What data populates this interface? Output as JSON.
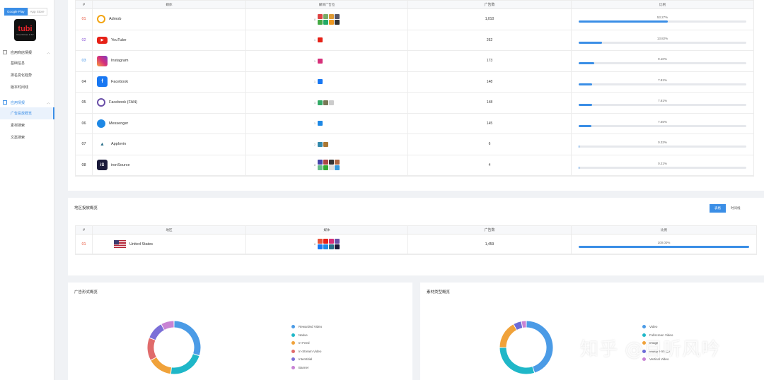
{
  "sidebar": {
    "store_tabs": [
      "Google Play",
      "App Store"
    ],
    "app_logo_text": "tubi",
    "app_logo_sub": "Free Movies & TV",
    "groups": [
      {
        "label": "应用商店情报",
        "items": [
          "基础信息",
          "排名变化趋势",
          "版本时间线"
        ]
      },
      {
        "label": "应用情报",
        "items": [
          "广告投放概览",
          "素材搜索",
          "文案搜索"
        ]
      }
    ]
  },
  "media_table": {
    "headers": [
      "#",
      "媒体",
      "媒体广告位",
      "广告数",
      "比例"
    ],
    "rows": [
      {
        "num": "01",
        "name": "Admob",
        "count": "1,010",
        "ratio": "53.27%",
        "pct": 53.27,
        "numColor": "#e8533b",
        "icon": "admob-icon",
        "iconColor": "#fff",
        "pos_n": "8",
        "thumbs": [
          "#d44",
          "#7a6",
          "#d93",
          "#556",
          "#4a4",
          "#2a6",
          "#e92",
          "#333"
        ]
      },
      {
        "num": "02",
        "name": "YouTube",
        "count": "262",
        "ratio": "13.82%",
        "pct": 13.82,
        "numColor": "#8a56d8",
        "icon": "youtube-icon",
        "iconColor": "#e62117",
        "pos_n": "1",
        "thumbs": [
          "#e62117"
        ]
      },
      {
        "num": "03",
        "name": "Instagram",
        "count": "173",
        "ratio": "9.10%",
        "pct": 9.1,
        "numColor": "#3a8ee6",
        "icon": "instagram-icon",
        "iconColor": "#d6307a",
        "pos_n": "1",
        "thumbs": [
          "#d6307a"
        ]
      },
      {
        "num": "04",
        "name": "Facebook",
        "count": "148",
        "ratio": "7.81%",
        "pct": 7.81,
        "numColor": "#333",
        "icon": "facebook-icon",
        "iconColor": "#1877f2",
        "pos_n": "1",
        "thumbs": [
          "#1877f2"
        ]
      },
      {
        "num": "05",
        "name": "Facebook (FAN)",
        "count": "148",
        "ratio": "7.81%",
        "pct": 7.81,
        "numColor": "#333",
        "icon": "facebook-fan-icon",
        "iconColor": "#6a4fa8",
        "pos_n": "3",
        "thumbs": [
          "#3a6",
          "#775",
          "#ccc"
        ]
      },
      {
        "num": "06",
        "name": "Messenger",
        "count": "145",
        "ratio": "7.65%",
        "pct": 7.65,
        "numColor": "#333",
        "icon": "messenger-icon",
        "iconColor": "#1e88e5",
        "pos_n": "1",
        "thumbs": [
          "#1e88e5"
        ]
      },
      {
        "num": "07",
        "name": "Applovin",
        "count": "6",
        "ratio": "0.33%",
        "pct": 0.33,
        "numColor": "#333",
        "icon": "applovin-icon",
        "iconColor": "#2a6f8a",
        "pos_n": "2",
        "thumbs": [
          "#38a",
          "#a73"
        ]
      },
      {
        "num": "08",
        "name": "ironSource",
        "count": "4",
        "ratio": "0.21%",
        "pct": 0.21,
        "numColor": "#333",
        "icon": "ironsource-icon",
        "iconColor": "#1a1a3a",
        "pos_n": "8",
        "thumbs": [
          "#44a",
          "#a44",
          "#333",
          "#a64",
          "#6b8",
          "#3a3",
          "#ddd",
          "#39d"
        ]
      }
    ]
  },
  "region": {
    "title": "地区投放概览",
    "toggle": [
      "表格",
      "时间线"
    ],
    "headers": [
      "#",
      "地区",
      "媒体",
      "广告数",
      "比例"
    ],
    "rows": [
      {
        "num": "01",
        "name": "United States",
        "count": "1,459",
        "ratio": "100.00%",
        "pct": 100,
        "pos_n": "8",
        "thumbs": [
          "#e8533b",
          "#e62117",
          "#d6307a",
          "#6a4fa8",
          "#1877f2",
          "#1e88e5",
          "#2a6f8a",
          "#1a1a3a"
        ]
      }
    ]
  },
  "ad_format": {
    "title": "广告形式概览",
    "legend": [
      {
        "label": "Rewarded Video",
        "color": "#4b9be6"
      },
      {
        "label": "Native",
        "color": "#1fb7c8"
      },
      {
        "label": "In-Feed",
        "color": "#f0a23a"
      },
      {
        "label": "In-Stream Video",
        "color": "#e06b6b"
      },
      {
        "label": "Interstitial",
        "color": "#7b6fd8"
      },
      {
        "label": "Banner",
        "color": "#c883d4"
      }
    ],
    "values": [
      30,
      22,
      15,
      14,
      11,
      8
    ]
  },
  "material": {
    "title": "素材类型概览",
    "legend": [
      {
        "label": "Video",
        "color": "#4b9be6"
      },
      {
        "label": "Fullscreen Video",
        "color": "#1fb7c8"
      },
      {
        "label": "Image",
        "color": "#f0a23a"
      },
      {
        "label": "Multiple Image",
        "color": "#6b6bd8"
      },
      {
        "label": "Vertical Video",
        "color": "#c883d4"
      }
    ],
    "values": [
      45,
      30,
      17,
      5,
      3
    ]
  },
  "watermark": "知乎 @目听风吟"
}
